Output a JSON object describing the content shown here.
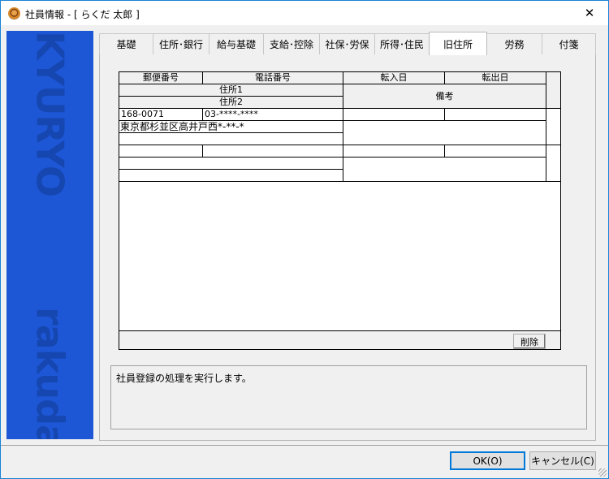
{
  "window": {
    "title": "社員情報 - [ らくだ 太郎 ]",
    "close_glyph": "✕"
  },
  "side_logo": {
    "top": "KYURYO",
    "bottom": "rakuda"
  },
  "tabs": [
    {
      "label": "基礎"
    },
    {
      "label": "住所･銀行"
    },
    {
      "label": "給与基礎"
    },
    {
      "label": "支給･控除"
    },
    {
      "label": "社保･労保"
    },
    {
      "label": "所得･住民"
    },
    {
      "label": "旧住所",
      "active": true
    },
    {
      "label": "労務"
    },
    {
      "label": "付箋"
    }
  ],
  "grid": {
    "headers": {
      "postal": "郵便番号",
      "phone": "電話番号",
      "move_in": "転入日",
      "move_out": "転出日",
      "address1": "住所1",
      "address2": "住所2",
      "remarks": "備考"
    },
    "records": [
      {
        "postal": "168-0071",
        "phone": "03-****-****",
        "address1": "東京都杉並区高井戸西*-**-*",
        "address2": "",
        "move_in": "",
        "move_out": "",
        "remarks": ""
      },
      {
        "postal": "",
        "phone": "",
        "address1": "",
        "address2": "",
        "move_in": "",
        "move_out": "",
        "remarks": ""
      }
    ],
    "delete_label": "削除"
  },
  "message": "社員登録の処理を実行します。",
  "buttons": {
    "ok": "OK(O)",
    "cancel": "キャンセル(C)"
  }
}
